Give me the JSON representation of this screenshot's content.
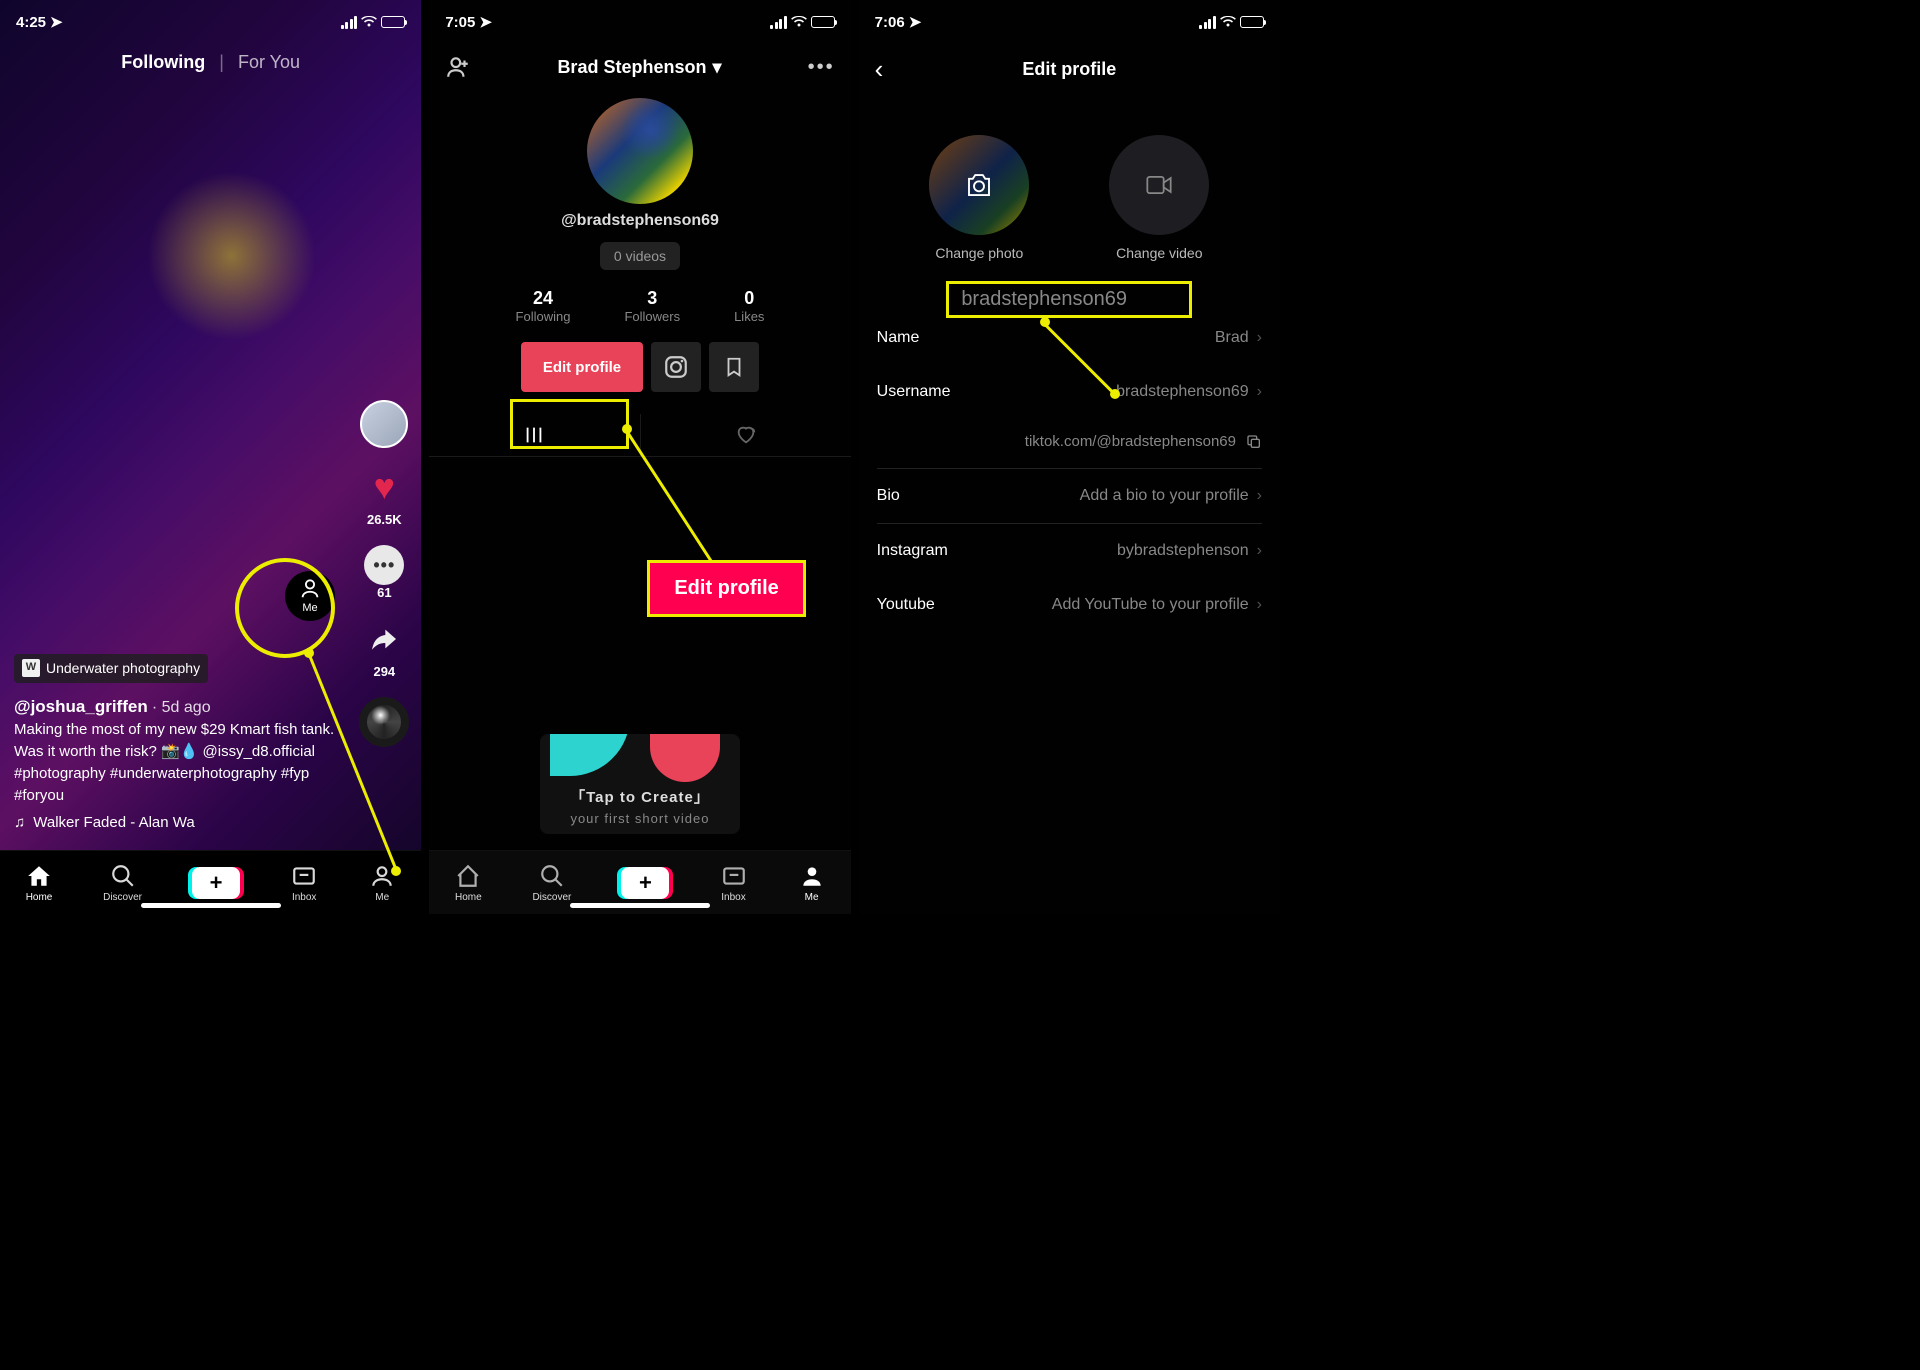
{
  "status": {
    "time1": "4:25",
    "time2": "7:05",
    "time3": "7:06"
  },
  "feed": {
    "tab_following": "Following",
    "tab_foryou": "For You",
    "likes": "26.5K",
    "comments": "61",
    "shares": "294",
    "badge": "Underwater photography",
    "user": "@joshua_griffen",
    "time": "5d ago",
    "caption": "Making the most of my new $29 Kmart fish tank. Was it worth the risk? 📸💧 @issy_d8.official #photography #underwaterphotography #fyp #foryou",
    "music": "Walker    Faded - Alan Wa",
    "me_label": "Me"
  },
  "nav": {
    "home": "Home",
    "discover": "Discover",
    "inbox": "Inbox",
    "me": "Me"
  },
  "profile": {
    "name": "Brad Stephenson",
    "handle": "@bradstephenson69",
    "videos": "0 videos",
    "following_n": "24",
    "following_l": "Following",
    "followers_n": "3",
    "followers_l": "Followers",
    "likes_n": "0",
    "likes_l": "Likes",
    "edit_btn": "Edit profile",
    "tap_create": "「Tap to Create」",
    "tap_sub": "your first short video"
  },
  "callout": {
    "edit_profile": "Edit profile",
    "username_text": "bradstephenson69"
  },
  "edit": {
    "title": "Edit profile",
    "change_photo": "Change photo",
    "change_video": "Change video",
    "name_label": "Name",
    "name_val": "Brad",
    "username_label": "Username",
    "username_val": "bradstephenson69",
    "url": "tiktok.com/@bradstephenson69",
    "bio_label": "Bio",
    "bio_val": "Add a bio to your profile",
    "ig_label": "Instagram",
    "ig_val": "bybradstephenson",
    "yt_label": "Youtube",
    "yt_val": "Add YouTube to your profile"
  }
}
